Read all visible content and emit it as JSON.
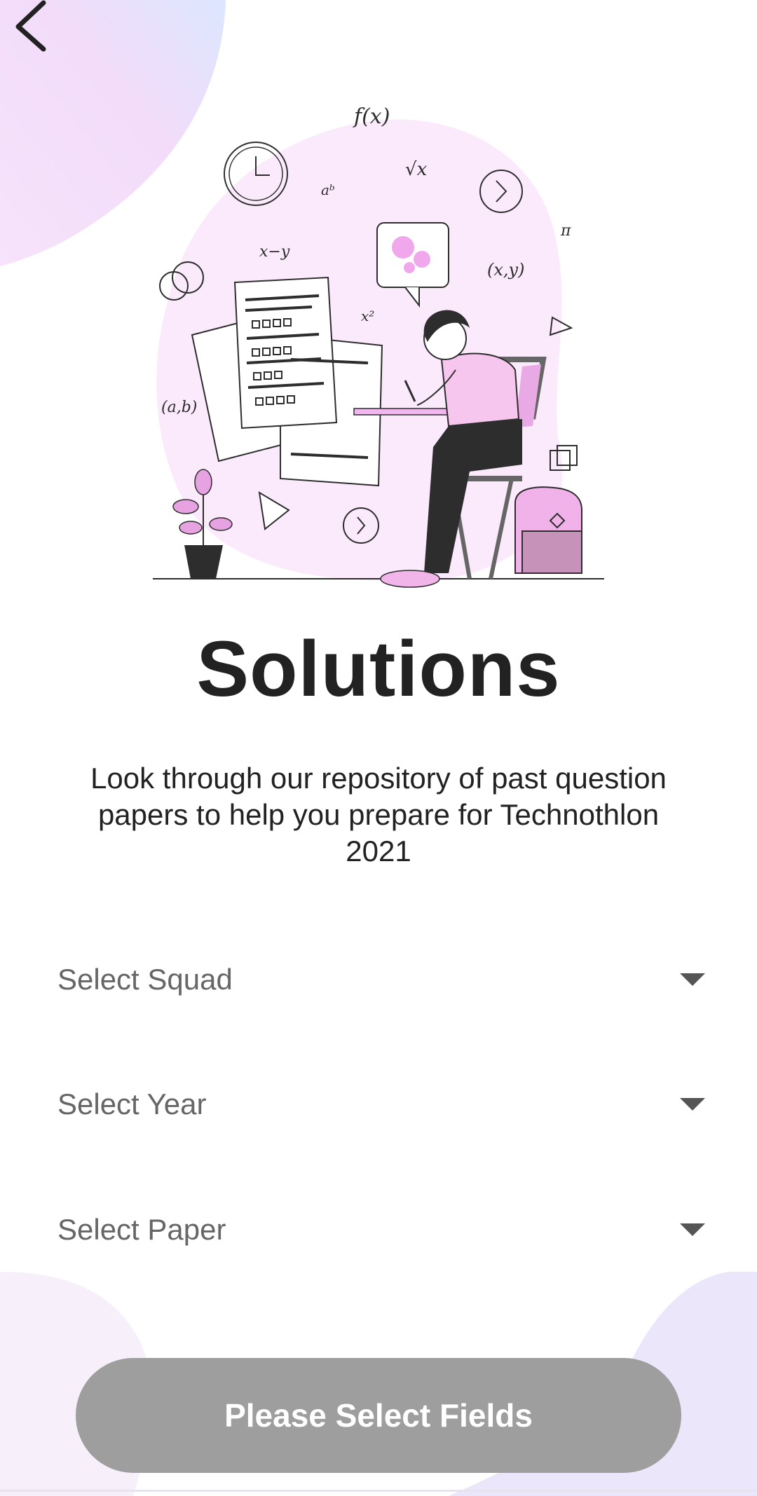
{
  "screen": {
    "title": "Solutions",
    "description": "Look through our repository of past question papers to help you prepare for Technothlon 2021"
  },
  "header": {
    "back_icon": "chevron-left-icon"
  },
  "illustration": {
    "subject": "student-writing-exam-icon",
    "formulas": [
      "f(x)",
      "√x",
      "aᵇ",
      "x−y",
      "x²",
      "(x,y)",
      "(a,b)",
      "π",
      "a",
      "b"
    ]
  },
  "form": {
    "fields": [
      {
        "label": "Select Squad",
        "icon": "caret-down-icon"
      },
      {
        "label": "Select Year",
        "icon": "caret-down-icon"
      },
      {
        "label": "Select Paper",
        "icon": "caret-down-icon"
      }
    ],
    "submit_label": "Please Select Fields"
  },
  "colors": {
    "button_disabled": "#9e9e9e",
    "blob_pink": "#f3ddfa",
    "blob_lavender": "#ece6fb",
    "text_primary": "#222222",
    "text_placeholder": "#666666"
  }
}
